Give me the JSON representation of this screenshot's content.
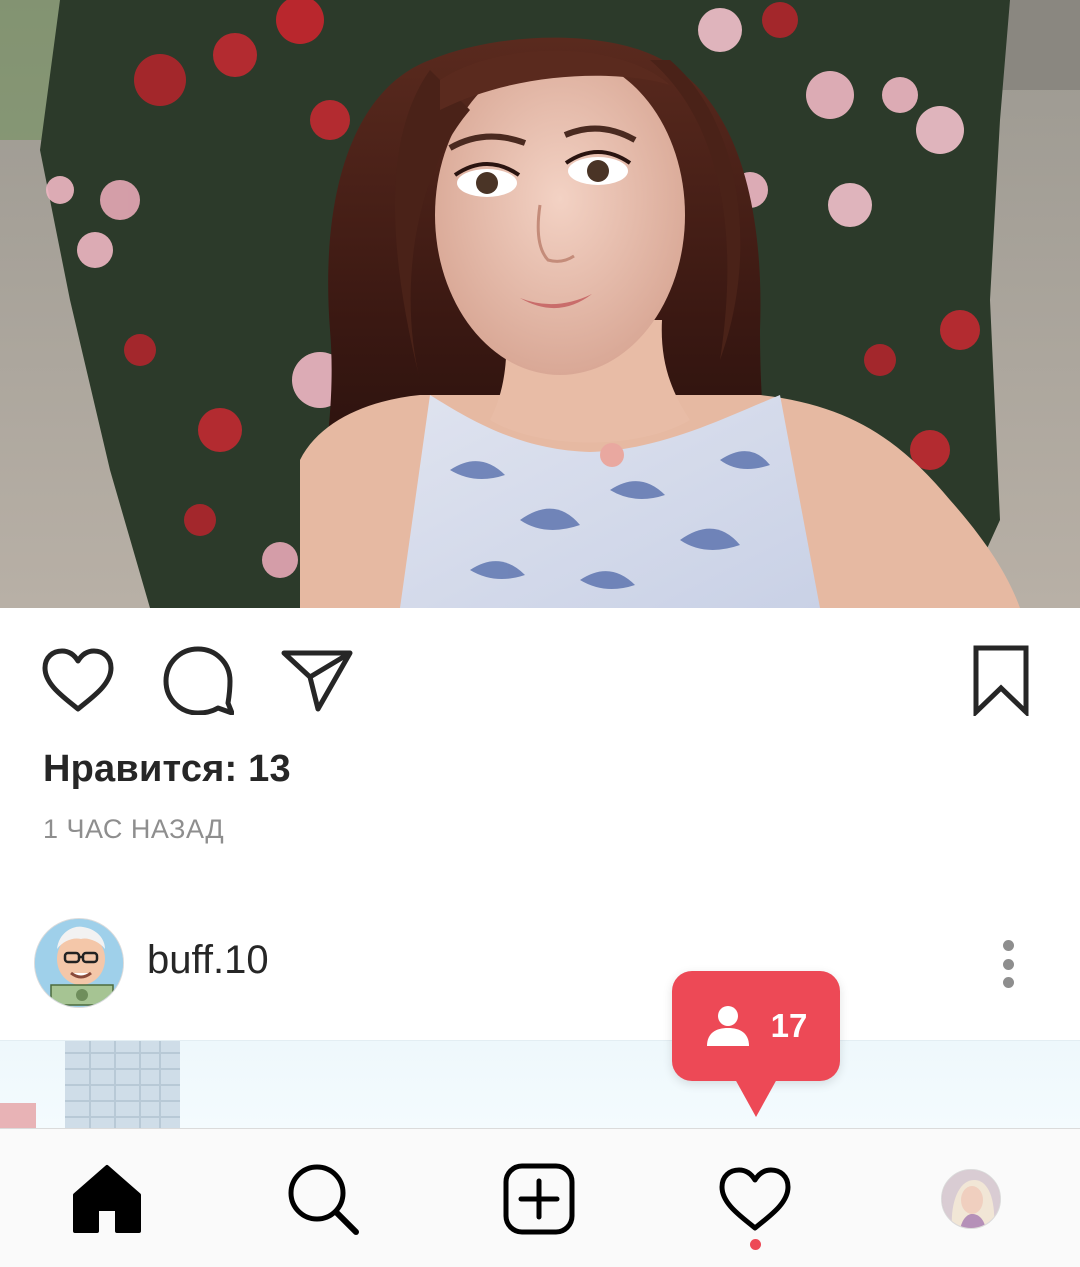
{
  "post": {
    "image_alt": "selfie",
    "likes_label": "Нравится: 13",
    "time_label": "1 час назад"
  },
  "actions": {
    "like_icon": "heart-outline-icon",
    "comment_icon": "comment-bubble-icon",
    "share_icon": "paper-plane-icon",
    "save_icon": "bookmark-icon"
  },
  "next_post": {
    "username": "buff.10",
    "avatar_icon": "avatar-cartoon",
    "menu_icon": "more-vertical-icon"
  },
  "activity_popup": {
    "icon": "person-icon",
    "count": "17"
  },
  "bottom_nav": {
    "items": [
      {
        "name": "home",
        "icon": "home-filled-icon",
        "active": true
      },
      {
        "name": "search",
        "icon": "search-icon"
      },
      {
        "name": "new-post",
        "icon": "plus-square-icon"
      },
      {
        "name": "activity",
        "icon": "heart-outline-icon",
        "badge_dot": true
      },
      {
        "name": "profile",
        "icon": "avatar"
      }
    ]
  },
  "colors": {
    "accent_red": "#ed4956",
    "text": "#262626",
    "muted": "#8e8e8e",
    "nav_bg": "#fafafa"
  }
}
